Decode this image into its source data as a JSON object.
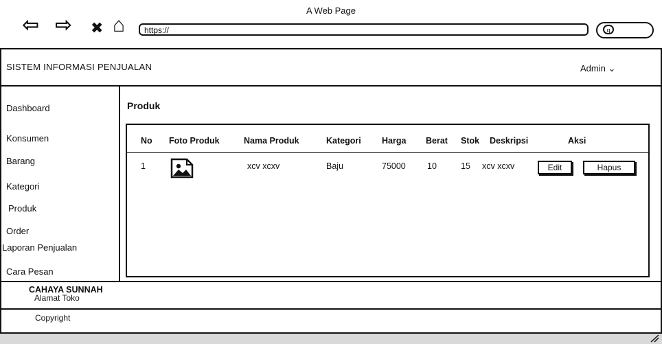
{
  "browser": {
    "window_title": "A Web Page",
    "url": "https://",
    "nav": {
      "back": "⇦",
      "forward": "⇨",
      "close": "✖",
      "home": "⌂"
    },
    "search_icon_glyph": "q"
  },
  "header": {
    "app_name": "SISTEM INFORMASI PENJUALAN",
    "user_menu": "Admin ⌄"
  },
  "sidebar": {
    "items": [
      {
        "label": "Dashboard"
      },
      {
        "label": "Konsumen"
      },
      {
        "label": "Barang"
      },
      {
        "label": "Kategori"
      },
      {
        "label": "Produk"
      },
      {
        "label": "Order"
      },
      {
        "label": "Laporan Penjualan"
      },
      {
        "label": "Cara  Pesan"
      }
    ]
  },
  "main": {
    "page_title": "Produk",
    "table": {
      "headers": [
        "No",
        "Foto Produk",
        "Nama Produk",
        "Kategori",
        "Harga",
        "Berat",
        "Stok",
        "Deskripsi",
        "Aksi"
      ],
      "rows": [
        {
          "no": "1",
          "foto": "image-icon",
          "nama": "xcv xcxv",
          "kategori": "Baju",
          "harga": "75000",
          "berat": "10",
          "stok": "15",
          "deskripsi": "xcv xcxv",
          "edit": "Edit",
          "hapus": "Hapus"
        }
      ]
    }
  },
  "footer": {
    "store_name": "CAHAYA SUNNAH",
    "store_address": "Alamat Toko",
    "copyright": "Copyright"
  }
}
